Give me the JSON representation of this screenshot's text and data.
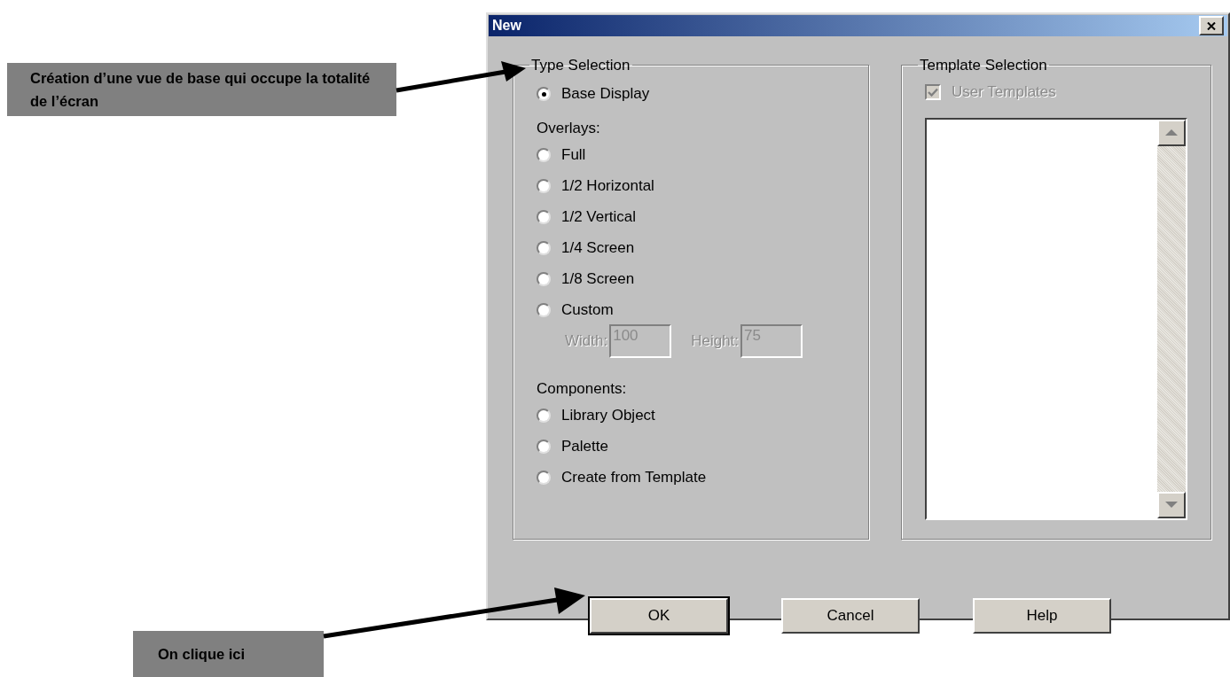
{
  "callouts": [
    {
      "text": "Création d’une vue de base qui occupe la totalité de l’écran"
    },
    {
      "text": "On clique ici"
    }
  ],
  "dialog": {
    "title": "New",
    "type_selection": {
      "title": "Type Selection",
      "items": [
        {
          "kind": "radio",
          "label": "Base Display",
          "selected": true
        },
        {
          "kind": "heading",
          "label": "Overlays:"
        },
        {
          "kind": "radio",
          "label": "Full",
          "selected": false
        },
        {
          "kind": "radio",
          "label": "1/2 Horizontal",
          "selected": false
        },
        {
          "kind": "radio",
          "label": "1/2 Vertical",
          "selected": false
        },
        {
          "kind": "radio",
          "label": "1/4 Screen",
          "selected": false
        },
        {
          "kind": "radio",
          "label": "1/8 Screen",
          "selected": false
        },
        {
          "kind": "radio",
          "label": "Custom",
          "selected": false
        },
        {
          "kind": "fields",
          "fields": [
            {
              "label": "Width:",
              "value": "100",
              "disabled": true
            },
            {
              "label": "Height:",
              "value": "75",
              "disabled": true
            }
          ]
        },
        {
          "kind": "heading",
          "label": "Components:"
        },
        {
          "kind": "radio",
          "label": "Library Object",
          "selected": false
        },
        {
          "kind": "radio",
          "label": "Palette",
          "selected": false
        },
        {
          "kind": "radio",
          "label": "Create from Template",
          "selected": false
        }
      ]
    },
    "template_selection": {
      "title": "Template Selection",
      "checkbox": {
        "label": "User Templates",
        "checked": true,
        "disabled": true
      }
    },
    "buttons": [
      {
        "label": "OK",
        "default": true
      },
      {
        "label": "Cancel",
        "default": false
      },
      {
        "label": "Help",
        "default": false
      }
    ]
  }
}
